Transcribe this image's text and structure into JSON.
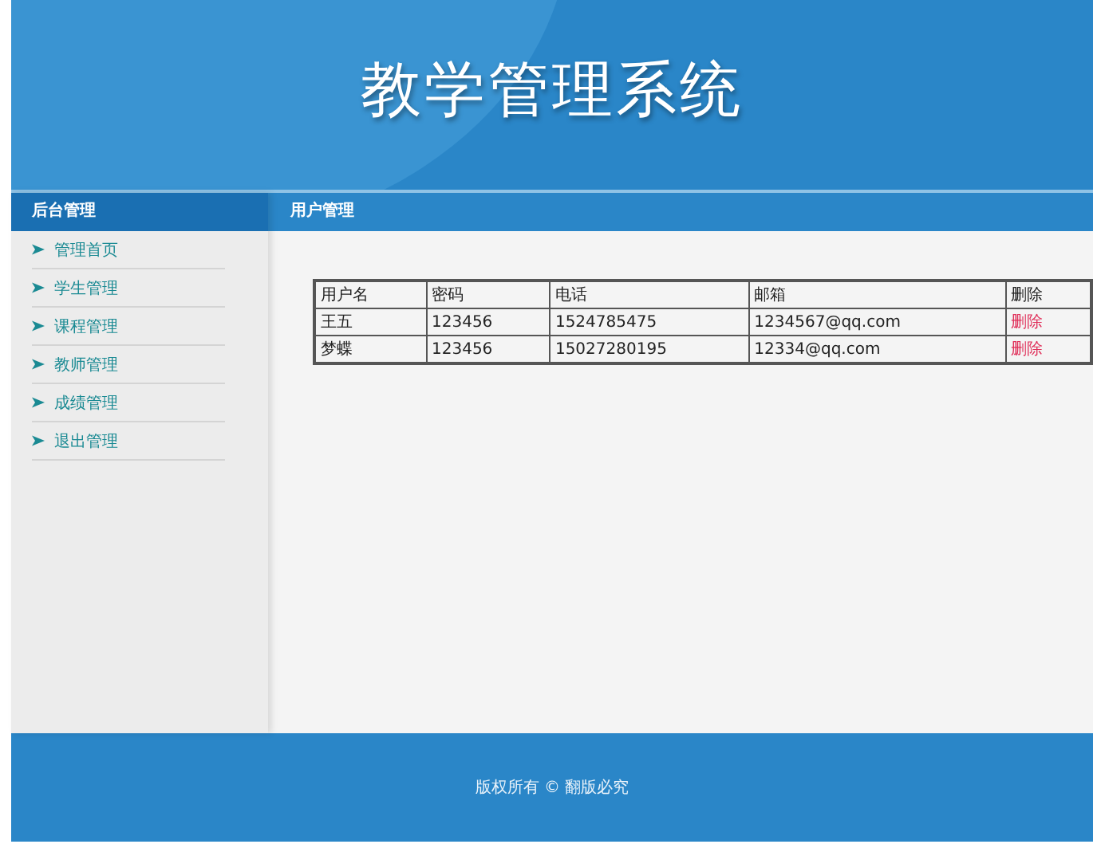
{
  "header": {
    "title": "教学管理系统"
  },
  "sidebar": {
    "title": "后台管理",
    "items": [
      {
        "label": "管理首页"
      },
      {
        "label": "学生管理"
      },
      {
        "label": "课程管理"
      },
      {
        "label": "教师管理"
      },
      {
        "label": "成绩管理"
      },
      {
        "label": "退出管理"
      }
    ]
  },
  "main": {
    "title": "用户管理",
    "table": {
      "columns": [
        "用户名",
        "密码",
        "电话",
        "邮箱",
        "删除"
      ],
      "rows": [
        {
          "cells": [
            "王五",
            "123456",
            "1524785475",
            "1234567@qq.com"
          ],
          "action": "删除"
        },
        {
          "cells": [
            "梦蝶",
            "123456",
            "15027280195",
            "12334@qq.com"
          ],
          "action": "删除"
        }
      ]
    }
  },
  "footer": {
    "text": "版权所有 © 翻版必究"
  }
}
